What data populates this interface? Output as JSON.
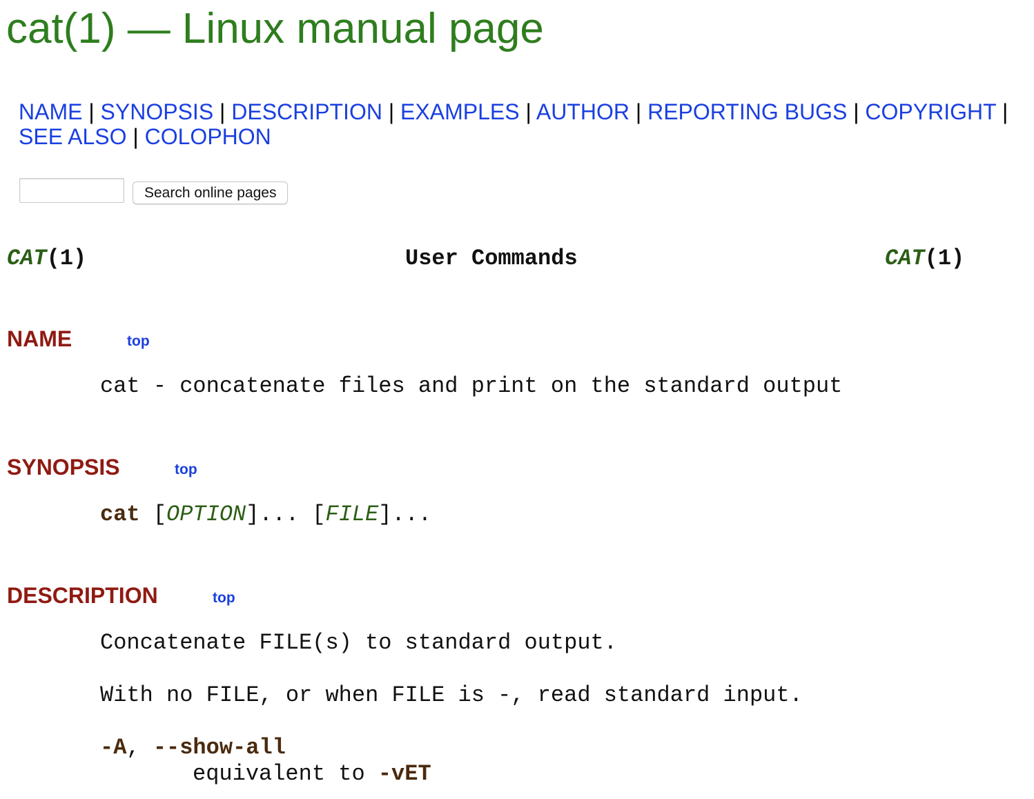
{
  "page": {
    "title": "cat(1) — Linux manual page"
  },
  "nav": {
    "separator": "|",
    "links": [
      "NAME",
      "SYNOPSIS",
      "DESCRIPTION",
      "EXAMPLES",
      "AUTHOR",
      "REPORTING BUGS",
      "COPYRIGHT",
      "SEE ALSO",
      "COLOPHON"
    ]
  },
  "search": {
    "value": "",
    "button_label": "Search online pages"
  },
  "man_header": {
    "left_name": "CAT",
    "left_section": "(1)",
    "center": "User Commands",
    "right_name": "CAT",
    "right_section": "(1)"
  },
  "sections": {
    "top_label": "top",
    "name": {
      "heading": "NAME",
      "text": "cat - concatenate files and print on the standard output"
    },
    "synopsis": {
      "heading": "SYNOPSIS",
      "command": "cat",
      "open1": " [",
      "arg1": "OPTION",
      "close1": "]... [",
      "arg2": "FILE",
      "close2": "]..."
    },
    "description": {
      "heading": "DESCRIPTION",
      "para1": "Concatenate FILE(s) to standard output.",
      "para2": "With no FILE, or when FILE is -, read standard input.",
      "option1": {
        "short": "-A",
        "sep": ", ",
        "long": "--show-all",
        "desc_prefix": "equivalent to ",
        "desc_flag": "-vET"
      }
    }
  },
  "colors": {
    "title_green": "#2e7d1e",
    "link_blue": "#1a3fe0",
    "heading_red": "#8f1a12",
    "bold_brown": "#4a2a0e",
    "italic_green": "#2b5e15"
  }
}
